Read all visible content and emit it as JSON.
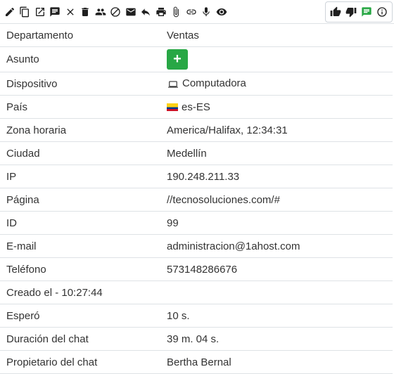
{
  "toolbar": {
    "icons": [
      "edit-icon",
      "copy-icon",
      "open-external-icon",
      "transcript-icon",
      "close-icon",
      "delete-icon",
      "transfer-icon",
      "block-icon",
      "mail-icon",
      "reply-icon",
      "print-icon",
      "attachment-icon",
      "link-icon",
      "microphone-icon",
      "eye-icon"
    ],
    "vote_icons": [
      "thumbs-up-icon",
      "thumbs-down-icon",
      "chat-note-icon",
      "info-icon"
    ],
    "accent": "#28a745"
  },
  "rows": [
    {
      "label": "Departamento",
      "value": "Ventas"
    },
    {
      "label": "Asunto",
      "value": "+"
    },
    {
      "label": "Dispositivo",
      "value": "Computadora"
    },
    {
      "label": "País",
      "value": "es-ES"
    },
    {
      "label": "Zona horaria",
      "value": "America/Halifax, 12:34:31"
    },
    {
      "label": "Ciudad",
      "value": "Medellín"
    },
    {
      "label": "IP",
      "value": "190.248.211.33"
    },
    {
      "label": "Página",
      "value": "//tecnosoluciones.com/#"
    },
    {
      "label": "ID",
      "value": "99"
    },
    {
      "label": "E-mail",
      "value": "administracion@1ahost.com"
    },
    {
      "label": "Teléfono",
      "value": "573148286676"
    },
    {
      "label": "Creado el - 10:27:44",
      "value": ""
    },
    {
      "label": "Esperó",
      "value": "10 s."
    },
    {
      "label": "Duración del chat",
      "value": "39 m. 04 s."
    },
    {
      "label": "Propietario del chat",
      "value": "Bertha Bernal"
    }
  ]
}
